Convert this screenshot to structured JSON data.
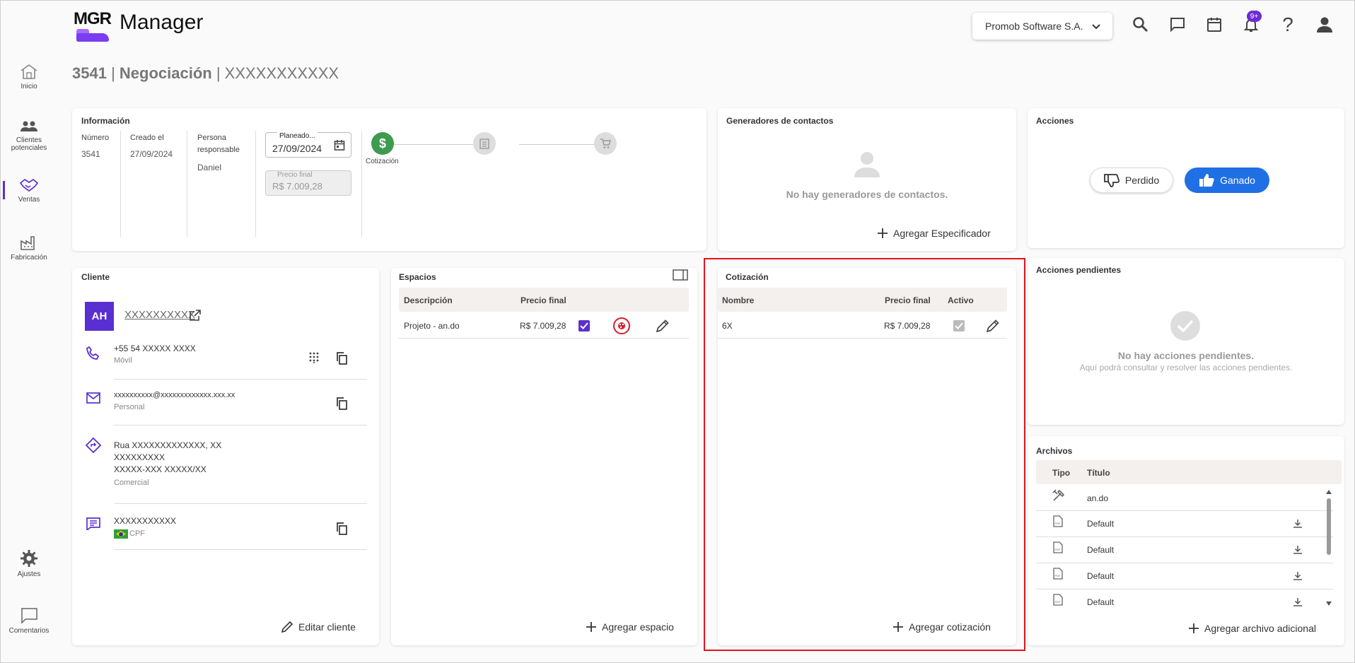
{
  "app": {
    "logo_text": "MGR",
    "name": "Manager",
    "company": "Promob Software S.A.",
    "notification_badge": "9+"
  },
  "colors": {
    "accent": "#5a2fd0",
    "won": "#1f6fe5",
    "success": "#3d9a4e",
    "highlight": "#e0141c"
  },
  "sidebar": {
    "items": [
      {
        "label": "Inicio",
        "icon": "home-icon"
      },
      {
        "label": "Clientes potenciales",
        "icon": "users-icon"
      },
      {
        "label": "Ventas",
        "icon": "handshake-icon"
      },
      {
        "label": "Fabricación",
        "icon": "factory-icon"
      },
      {
        "label": "Ajustes",
        "icon": "gear-icon"
      },
      {
        "label": "Comentarios",
        "icon": "comment-icon"
      }
    ]
  },
  "page": {
    "title_id": "3541",
    "title_sep": " | ",
    "title_type": "Negociación",
    "title_name": "| XXXXXXXXXXX"
  },
  "informacion": {
    "title": "Información",
    "numero_label": "Número",
    "numero": "3541",
    "creado_label": "Creado el",
    "creado": "27/09/2024",
    "persona_label1": "Persona",
    "persona_label2": "responsable",
    "persona": "Daniel",
    "planeado_label": "Planeado...",
    "planeado": "27/09/2024",
    "precio_label": "Precio final",
    "precio": "R$ 7.009,28",
    "step1": "Cotización"
  },
  "generadores": {
    "title": "Generadores de contactos",
    "empty": "No hay generadores de contactos.",
    "add": "Agregar Especificador"
  },
  "acciones": {
    "title": "Acciones",
    "lost": "Perdido",
    "won": "Ganado"
  },
  "pendientes": {
    "title": "Acciones pendientes",
    "empty_title": "No hay acciones pendientes.",
    "empty_sub": "Aquí podrá consultar y resolver las acciones pendientes."
  },
  "cliente": {
    "title": "Cliente",
    "initials": "AH",
    "name": "XXXXXXXXXX",
    "phone": "+55 54 XXXXX XXXX",
    "phone_type": "Móvil",
    "email": "xxxxxxxxxx@xxxxxxxxxxxxx.xxx.xx",
    "email_type": "Personal",
    "addr1": "Rua XXXXXXXXXXXXX, XX",
    "addr2": "XXXXXXXXX",
    "addr3": "XXXXX-XXX  XXXXX/XX",
    "addr_type": "Comercial",
    "doc": "XXXXXXXXXXX",
    "doc_type": "CPF",
    "edit": "Editar cliente"
  },
  "espacios": {
    "title": "Espacios",
    "col_desc": "Descripción",
    "col_precio": "Precio final",
    "rows": [
      {
        "desc": "Projeto - an.do",
        "precio": "R$ 7.009,28"
      }
    ],
    "add": "Agregar espacio"
  },
  "cotizacion": {
    "title": "Cotización",
    "col_nombre": "Nombre",
    "col_precio": "Precio final",
    "col_activo": "Activo",
    "rows": [
      {
        "nombre": "6X",
        "precio": "R$ 7.009,28"
      }
    ],
    "add": "Agregar cotización"
  },
  "archivos": {
    "title": "Archivos",
    "col_tipo": "Tipo",
    "col_titulo": "Título",
    "rows": [
      {
        "titulo": "an.do",
        "tipo": "tools-icon"
      },
      {
        "titulo": "Default",
        "tipo": "pdf-icon"
      },
      {
        "titulo": "Default",
        "tipo": "pdf-icon"
      },
      {
        "titulo": "Default",
        "tipo": "pdf-icon"
      },
      {
        "titulo": "Default",
        "tipo": "pdf-icon"
      }
    ],
    "add": "Agregar archivo adicional"
  }
}
